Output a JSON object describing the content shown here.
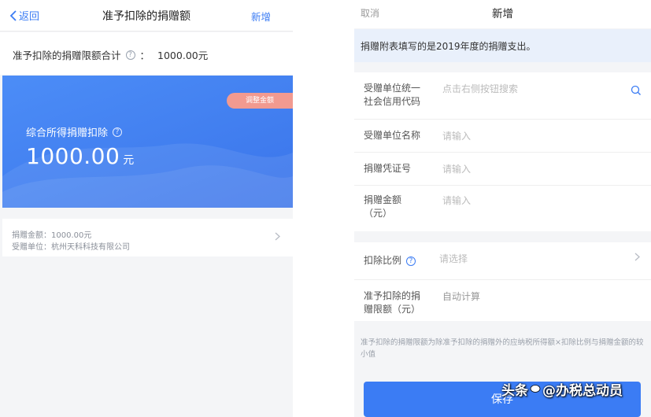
{
  "left": {
    "nav": {
      "back": "返回",
      "title": "准予扣除的捐赠额",
      "add": "新增"
    },
    "total": {
      "label": "准予扣除的捐赠限额合计",
      "colon": "：",
      "value": "1000.00元"
    },
    "card": {
      "adjust": "调整金额",
      "label": "综合所得捐赠扣除",
      "amount": "1000.00",
      "unit": "元"
    },
    "record": {
      "line1": "捐赠金额：1000.00元",
      "line2": "受赠单位：杭州天科科技有限公司"
    }
  },
  "right": {
    "nav": {
      "cancel": "取消",
      "title": "新增"
    },
    "notice": "捐赠附表填写的是2019年度的捐赠支出。",
    "fields": [
      {
        "label1": "受赠单位统一",
        "label2": "社会信用代码",
        "placeholder": "点击右侧按钮搜索"
      },
      {
        "label1": "受赠单位名称",
        "label2": "",
        "placeholder": "请输入"
      },
      {
        "label1": "捐赠凭证号",
        "label2": "",
        "placeholder": "请输入"
      },
      {
        "label1": "捐赠金额",
        "label2": "（元）",
        "placeholder": "请输入"
      }
    ],
    "ratio": {
      "label": "扣除比例",
      "placeholder": "请选择"
    },
    "limit": {
      "label1": "准予扣除的捐",
      "label2": "赠限额（元）",
      "value": "自动计算"
    },
    "note": "准予扣除的捐赠限额为除准予扣除的捐赠外的应纳税所得额×扣除比例与捐赠金额的较小值",
    "save": "保存"
  },
  "watermark": {
    "prefix": "头条",
    "handle": "@办税总动员"
  },
  "colors": {
    "primary": "#3b7cf4",
    "badge": "#f29a90",
    "notice_bg": "#e9f0fb"
  }
}
